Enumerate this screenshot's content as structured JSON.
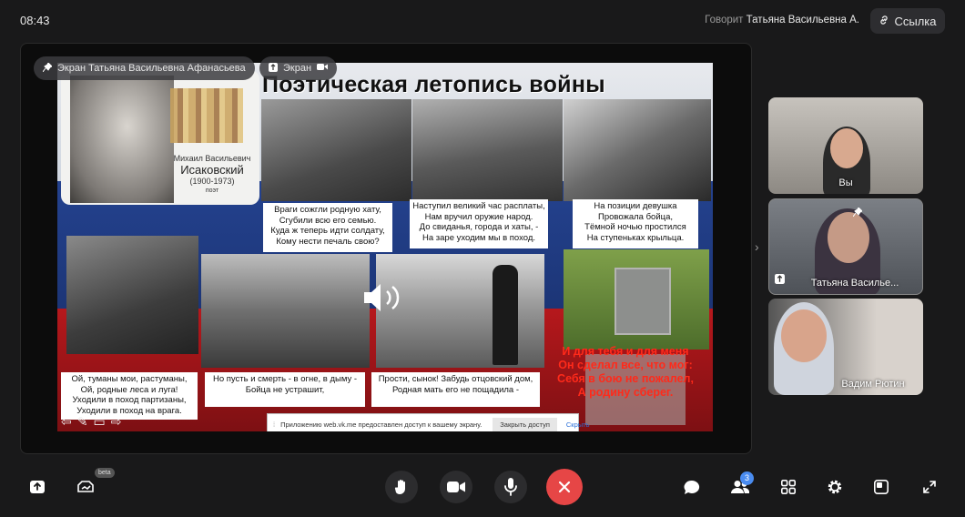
{
  "status_bar": {
    "time": "08:43"
  },
  "header": {
    "speaking_prefix": "Говорит",
    "speaking_name": "Татьяна Васильевна А.",
    "link_button": "Ссылка"
  },
  "screen_share": {
    "pinned_label": "Экран Татьяна Васильевна Афанасьева",
    "screen_label": "Экран"
  },
  "slide": {
    "title": "Поэтическая летопись войны",
    "poet": {
      "first": "Михаил Васильевич",
      "last": "Исаковский",
      "years": "(1900-1973)",
      "role": "поэт"
    },
    "verses": {
      "v1": [
        "Враги сожгли родную хату,",
        "Сгубили всю его семью.",
        "Куда ж теперь идти солдату,",
        "Кому нести печаль свою?"
      ],
      "v2": [
        "Наступил великий час расплаты,",
        "Нам вручил оружие народ.",
        "До свиданья, города и хаты, -",
        "На заре уходим мы в поход."
      ],
      "v3": [
        "На позиции девушка",
        "Провожала бойца,",
        "Тёмной ночью простился",
        "На ступеньках крыльца."
      ],
      "v4": [
        "Ой, туманы мои, растуманы,",
        "Ой, родные леса и луга!",
        "Уходили в поход партизаны,",
        "Уходили в поход на врага."
      ],
      "v5": [
        "Но пусть и смерть - в огне, в дыму -",
        "Бойца не устрашит,"
      ],
      "v6": [
        "Прости, сынок! Забудь отцовский дом,",
        "Родная мать его не пощадила -"
      ],
      "red": [
        "И для тебя и для меня",
        "Он сделал все, что мог:",
        "Себя в бою не пожалел,",
        "А родину сберег."
      ]
    },
    "share_toast": {
      "message": "Приложению web.vk.me предоставлен доступ к вашему экрану.",
      "stop_button": "Закрыть доступ",
      "hide_button": "Скрыть"
    }
  },
  "participants": [
    {
      "name": "Вы"
    },
    {
      "name": "Татьяна Василье..."
    },
    {
      "name": "Вадим Рютин"
    }
  ],
  "toolbar": {
    "beta_label": "beta",
    "participants_count": "3",
    "icons": [
      "share-screen-icon",
      "effects-icon",
      "raise-hand-icon",
      "camera-icon",
      "microphone-icon",
      "end-call-icon",
      "chat-icon",
      "participants-icon",
      "layout-grid-icon",
      "settings-icon",
      "picture-in-picture-icon",
      "fullscreen-icon"
    ]
  },
  "colors": {
    "background": "#19191a",
    "end_call": "#e64646",
    "accent": "#4a8cf0"
  }
}
